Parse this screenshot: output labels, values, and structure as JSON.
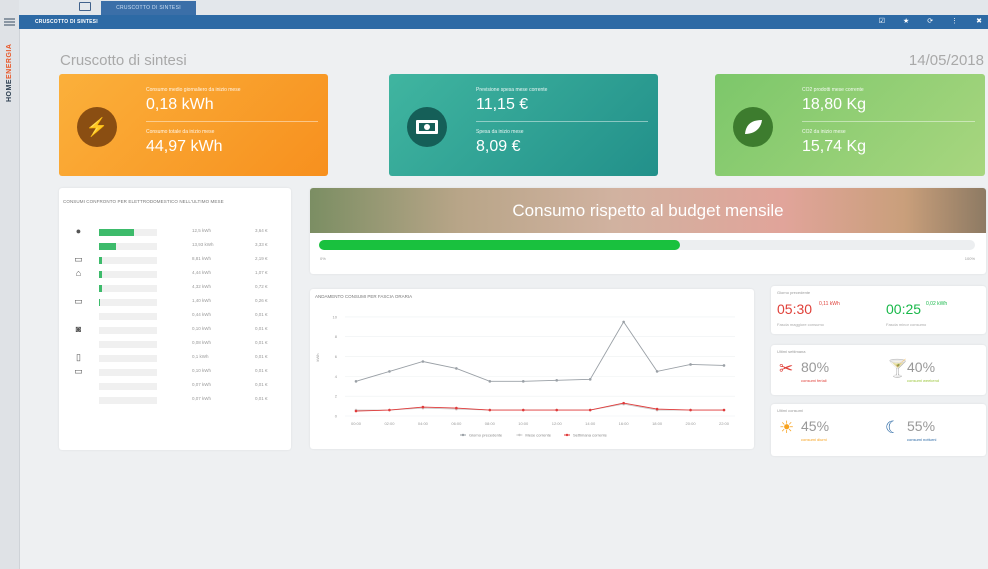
{
  "sidebar": {
    "brand_main": "HOME",
    "brand_accent": "ENERGIA"
  },
  "header": {
    "tab_label": "CRUSCOTTO DI SINTESI",
    "section_title": "CRUSCOTTO DI SINTESI",
    "icons": [
      "check-icon",
      "star-icon",
      "refresh-icon",
      "more-icon",
      "close-icon"
    ]
  },
  "page": {
    "title": "Cruscotto di sintesi",
    "date": "14/05/2018"
  },
  "kpis": {
    "energy": {
      "label1": "Consumo medio giornaliero da inizio mese",
      "value1": "0,18 kWh",
      "label2": "Consumo totale da inizio mese",
      "value2": "44,97 kWh",
      "color": "#f7901e"
    },
    "cost": {
      "label1": "Previsione spesa mese corrente",
      "value1": "11,15 €",
      "label2": "Spesa da inizio mese",
      "value2": "8,09 €",
      "color": "#22908a"
    },
    "co2": {
      "label1": "CO2 prodotti mese corrente",
      "value1": "18,80 Kg",
      "label2": "CO2 da inizio mese",
      "value2": "15,74 Kg",
      "color": "#7cc76a"
    }
  },
  "appliances": {
    "title": "CONSUMI CONFRONTO PER ELETTRODOMESTICO NELL'ULTIMO MESE",
    "rows": [
      {
        "icon": "●",
        "fraction": 0.6,
        "kwh": "12,5 kWh",
        "eur": "3,64 €"
      },
      {
        "icon": "",
        "fraction": 0.3,
        "kwh": "13,93 kWh",
        "eur": "3,33 €"
      },
      {
        "icon": "▭",
        "fraction": 0.05,
        "kwh": "8,81 kWh",
        "eur": "2,19 €"
      },
      {
        "icon": "⌂",
        "fraction": 0.05,
        "kwh": "4,44 kWh",
        "eur": "1,07 €"
      },
      {
        "icon": "",
        "fraction": 0.05,
        "kwh": "4,32 kWh",
        "eur": "0,72 €"
      },
      {
        "icon": "▭",
        "fraction": 0.02,
        "kwh": "1,40 kWh",
        "eur": "0,26 €"
      },
      {
        "icon": "",
        "fraction": 0.0,
        "kwh": "0,44 kWh",
        "eur": "0,01 €"
      },
      {
        "icon": "◙",
        "fraction": 0.0,
        "kwh": "0,10 kWh",
        "eur": "0,01 €"
      },
      {
        "icon": "",
        "fraction": 0.0,
        "kwh": "0,08 kWh",
        "eur": "0,01 €"
      },
      {
        "icon": "▯",
        "fraction": 0.0,
        "kwh": "0,1 kWh",
        "eur": "0,01 €"
      },
      {
        "icon": "▭",
        "fraction": 0.0,
        "kwh": "0,10 kWh",
        "eur": "0,01 €"
      },
      {
        "icon": "",
        "fraction": 0.0,
        "kwh": "0,07 kWh",
        "eur": "0,01 €"
      },
      {
        "icon": "",
        "fraction": 0.0,
        "kwh": "0,07 kWh",
        "eur": "0,01 €"
      }
    ]
  },
  "budget": {
    "title": "Consumo rispetto al budget mensile",
    "progress": 0.55,
    "min_label": "0%",
    "max_label": "100%"
  },
  "chart_data": {
    "type": "line",
    "title": "ANDAMENTO CONSUMI PER FASCIA ORARIA",
    "ylabel": "kWh",
    "x": [
      "00:00",
      "02:00",
      "04:00",
      "06:00",
      "08:00",
      "10:00",
      "12:00",
      "14:00",
      "16:00",
      "18:00",
      "20:00",
      "22:00"
    ],
    "yticks": [
      0,
      2,
      4,
      6,
      8,
      10
    ],
    "ylim": [
      0,
      11
    ],
    "series": [
      {
        "name": "Giorno precedente",
        "color": "#9aa0a6",
        "values": [
          3.5,
          4.5,
          5.5,
          4.8,
          3.5,
          3.5,
          3.6,
          3.7,
          9.5,
          4.5,
          5.2,
          5.1
        ]
      },
      {
        "name": "Mese corrente",
        "color": "#c8c8c8",
        "values": [
          0.6,
          0.6,
          0.8,
          0.7,
          0.6,
          0.6,
          0.6,
          0.6,
          1.2,
          0.6,
          0.6,
          0.6
        ]
      },
      {
        "name": "Settimana corrente",
        "color": "#e03a3a",
        "values": [
          0.5,
          0.6,
          0.9,
          0.8,
          0.6,
          0.6,
          0.6,
          0.6,
          1.3,
          0.7,
          0.6,
          0.6
        ]
      }
    ]
  },
  "stats": {
    "yesterday": {
      "title": "Giorno precedente",
      "peak_time": "05:30",
      "peak_value": "0,11 kWh",
      "peak_label": "Fascia maggiore consumo",
      "low_time": "00:25",
      "low_value": "0,02 kWh",
      "low_label": "Fascia minor consumo"
    },
    "week": {
      "title": "Ultimi settimana",
      "pct1": "80%",
      "label1": "consumi feriali",
      "pct2": "40%",
      "label2": "consumi weekend"
    },
    "month": {
      "title": "Ultimi consumi",
      "pct1": "45%",
      "label1": "consumi diurni",
      "pct2": "55%",
      "label2": "consumi notturni"
    }
  }
}
